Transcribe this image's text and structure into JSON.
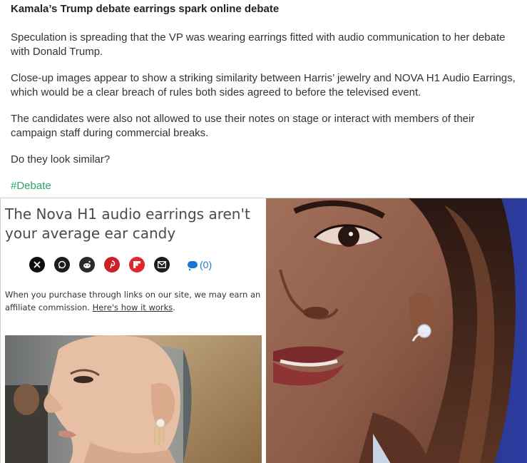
{
  "post": {
    "title": "Kamala’s Trump debate earrings spark online debate",
    "paragraphs": [
      "Speculation is spreading that the VP was wearing earrings fitted with audio communication to her debate with Donald Trump.",
      "Close-up images appear to show a striking similarity between Harris’ jewelry and NOVA H1 Audio Earrings, which would be a clear breach of rules both sides agreed to before the televised event.",
      "The candidates were also not allowed to use their notes on stage or interact with members of their campaign staff during commercial breaks.",
      "Do they look similar?"
    ],
    "hashtag": "#Debate"
  },
  "image": {
    "left": {
      "headline": "The Nova H1 audio earrings aren't your average ear candy",
      "share_icons": [
        "x-icon",
        "whatsapp-icon",
        "reddit-icon",
        "pinterest-icon",
        "flipboard-icon",
        "mail-icon"
      ],
      "comment_count": "(0)",
      "disclaimer_text": "When you purchase through links on our site, we may earn an affiliate commission. ",
      "disclaimer_link": "Here's how it works",
      "disclaimer_end": "."
    },
    "colors": {
      "hashtag": "#2aa46a",
      "pinterest": "#cc2127",
      "flipboard": "#e12828",
      "comment": "#1976d2"
    }
  }
}
